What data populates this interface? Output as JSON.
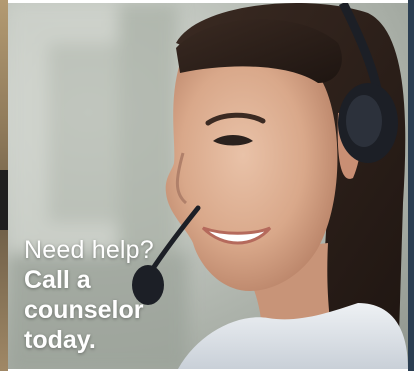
{
  "banner": {
    "headline_light": "Need help?",
    "headline_bold_line1": "Call a",
    "headline_bold_line2": "counselor",
    "headline_bold_line3": "today."
  },
  "colors": {
    "caption_text": "#ffffff",
    "background_blur": "#c2c7c0",
    "headset": "#1c1f26"
  },
  "image": {
    "subject": "smiling woman wearing headset"
  }
}
